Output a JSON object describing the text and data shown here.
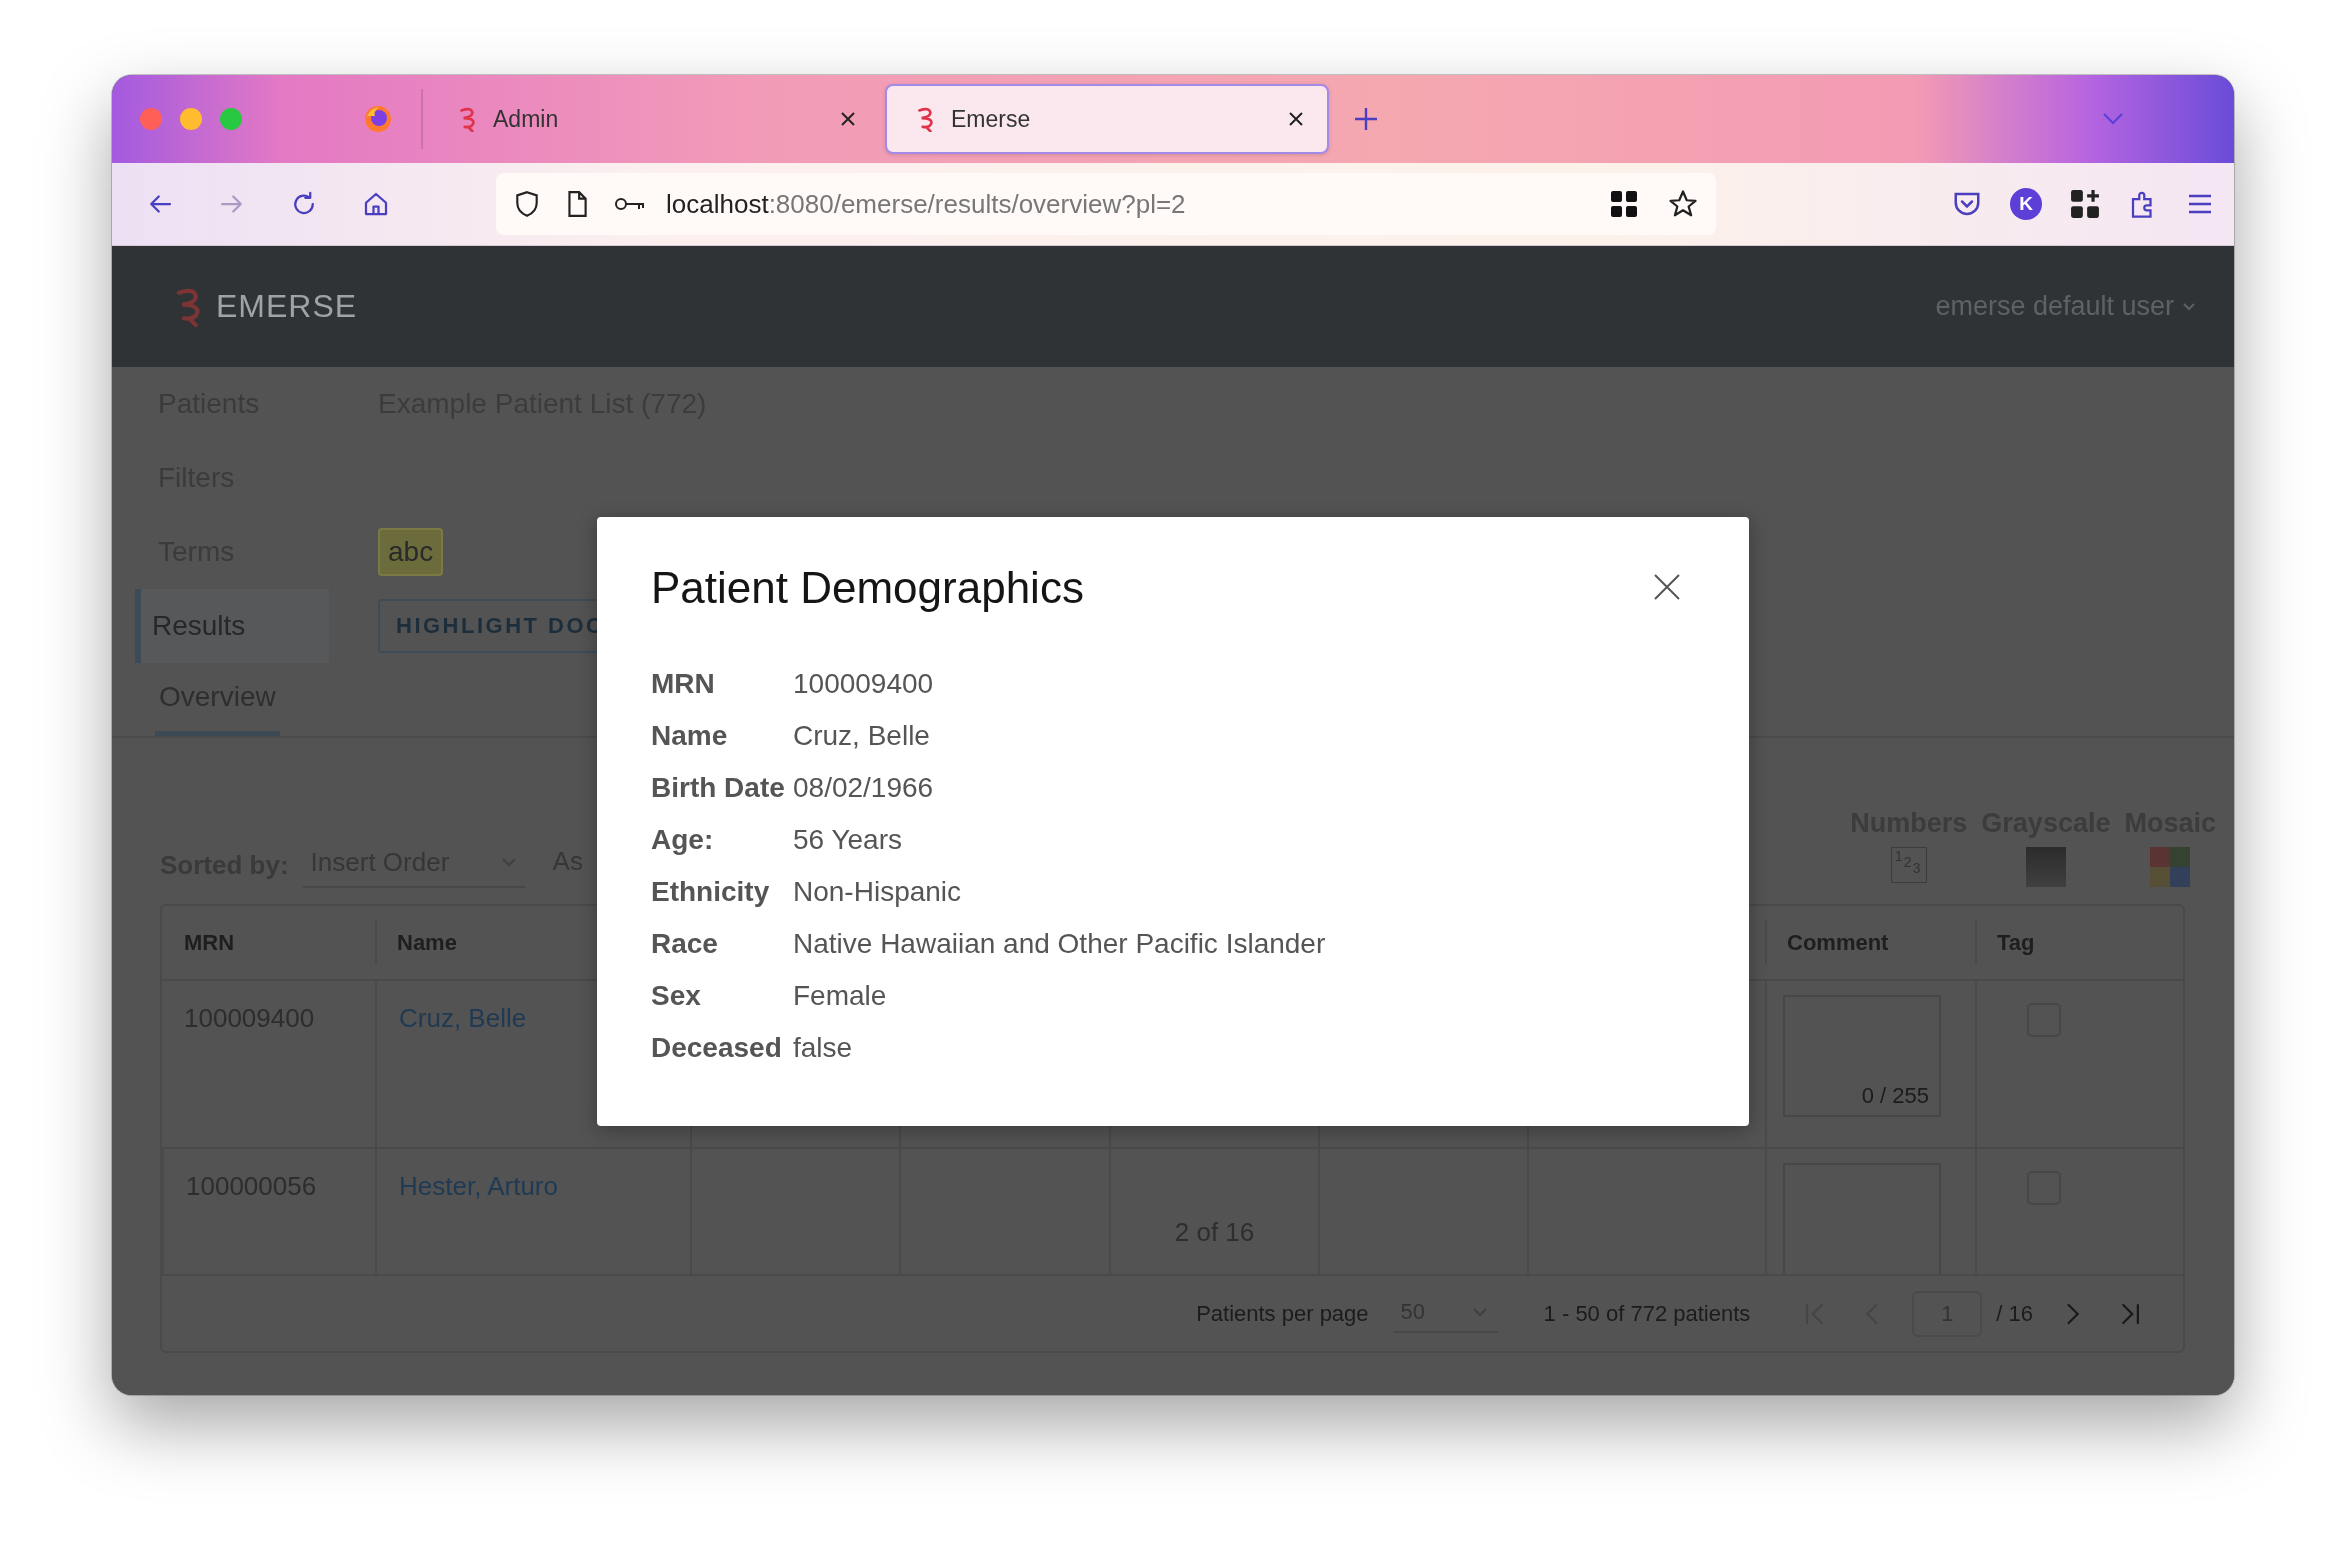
{
  "browser": {
    "tabs": [
      {
        "title": "Admin",
        "selected": false
      },
      {
        "title": "Emerse",
        "selected": true
      }
    ],
    "nav_buttons": [
      {
        "kind": "back",
        "disabled": false
      },
      {
        "kind": "forward",
        "disabled": true
      },
      {
        "kind": "reload",
        "disabled": false
      },
      {
        "kind": "home",
        "disabled": false
      }
    ],
    "url": {
      "host": "localhost",
      "path": ":8080/emerse/results/overview?pl=2"
    },
    "account_initial": "K"
  },
  "app": {
    "brand": "EMERSE",
    "user_menu": "emerse default user"
  },
  "sidebar": {
    "items": [
      {
        "label": "Patients",
        "selected": false
      },
      {
        "label": "Filters",
        "selected": false
      },
      {
        "label": "Terms",
        "selected": false
      },
      {
        "label": "Results",
        "selected": true
      }
    ]
  },
  "patient_list": "Example Patient List (772)",
  "terms": [
    "abc"
  ],
  "highlight_button": "HIGHLIGHT DOC",
  "tabs": [
    {
      "label": "Overview",
      "selected": true
    }
  ],
  "sort": {
    "label": "Sorted by:",
    "value": "Insert Order",
    "order": "As"
  },
  "view_modes": [
    {
      "kind": "numbers",
      "label": "Numbers",
      "glyph": "123"
    },
    {
      "kind": "grayscale",
      "label": "Grayscale"
    },
    {
      "kind": "mosaic",
      "label": "Mosaic"
    }
  ],
  "table": {
    "columns": [
      "MRN",
      "Name",
      "Comment",
      "Tag"
    ],
    "rows": [
      {
        "mrn": "100009400",
        "name": "Cruz, Belle",
        "comment_count": "0 / 255",
        "tagged": false
      },
      {
        "mrn": "100000056",
        "name": "Hester, Arturo",
        "column_5": "2 of 16",
        "tagged": false
      }
    ]
  },
  "pagination": {
    "per_page_label": "Patients per page",
    "per_page": "50",
    "range": "1 - 50 of 772 patients",
    "page": "1",
    "total_pages": "/ 16",
    "buttons": [
      {
        "kind": "first",
        "disabled": true
      },
      {
        "kind": "prev",
        "disabled": true
      },
      {
        "kind": "next",
        "disabled": false
      },
      {
        "kind": "last",
        "disabled": false
      }
    ]
  },
  "modal": {
    "title": "Patient Demographics",
    "fields": [
      {
        "label": "MRN",
        "value": "100009400"
      },
      {
        "label": "Name",
        "value": "Cruz, Belle"
      },
      {
        "label": "Birth Date",
        "value": "08/02/1966"
      },
      {
        "label": "Age:",
        "value": "56 Years"
      },
      {
        "label": "Ethnicity",
        "value": "Non-Hispanic"
      },
      {
        "label": "Race",
        "value": "Native Hawaiian and Other Pacific Islander"
      },
      {
        "label": "Sex",
        "value": "Female"
      },
      {
        "label": "Deceased",
        "value": "false"
      }
    ]
  }
}
